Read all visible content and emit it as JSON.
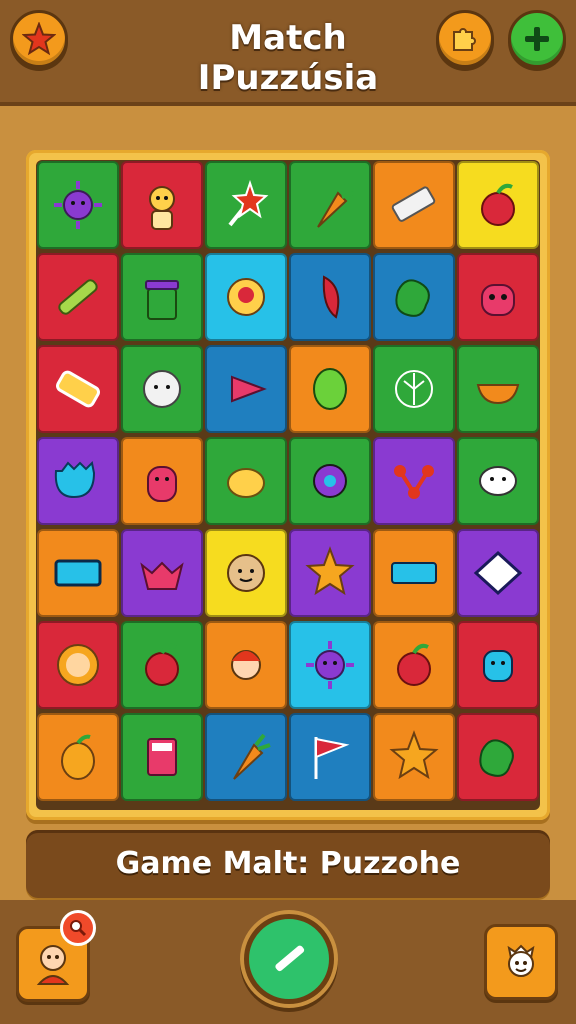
{
  "header": {
    "title_line1": "Match",
    "title_line2": "IPuzzúsia",
    "star_icon": "star-icon",
    "puzzle_icon": "puzzle-icon",
    "add_icon": "plus-icon"
  },
  "board": {
    "rows": 7,
    "cols": 6,
    "tiles": [
      [
        "green",
        "sun-face"
      ],
      [
        "red",
        "person"
      ],
      [
        "green",
        "star-wand"
      ],
      [
        "green",
        "carrot"
      ],
      [
        "orange",
        "eraser"
      ],
      [
        "yellow",
        "apple"
      ],
      [
        "red",
        "stick"
      ],
      [
        "green",
        "bin"
      ],
      [
        "cyan",
        "gem"
      ],
      [
        "blue",
        "chili"
      ],
      [
        "blue",
        "blob"
      ],
      [
        "red",
        "monster"
      ],
      [
        "red",
        "battery"
      ],
      [
        "green",
        "ball-face"
      ],
      [
        "blue",
        "play-arrow"
      ],
      [
        "orange",
        "bean"
      ],
      [
        "green",
        "leaf-ball"
      ],
      [
        "green",
        "bowl"
      ],
      [
        "purple",
        "robot"
      ],
      [
        "orange",
        "cat"
      ],
      [
        "green",
        "lemon"
      ],
      [
        "green",
        "orb"
      ],
      [
        "purple",
        "molecule"
      ],
      [
        "green",
        "speech-face"
      ],
      [
        "orange",
        "screen"
      ],
      [
        "purple",
        "bird"
      ],
      [
        "yellow",
        "face"
      ],
      [
        "purple",
        "star"
      ],
      [
        "orange",
        "toggle"
      ],
      [
        "purple",
        "diamond"
      ],
      [
        "red",
        "lion"
      ],
      [
        "green",
        "apple"
      ],
      [
        "orange",
        "boy"
      ],
      [
        "cyan",
        "sun-face"
      ],
      [
        "orange",
        "apple"
      ],
      [
        "red",
        "robot-head"
      ],
      [
        "orange",
        "mango"
      ],
      [
        "green",
        "calculator"
      ],
      [
        "blue",
        "carrot"
      ],
      [
        "blue",
        "flag"
      ],
      [
        "orange",
        "star"
      ],
      [
        "red",
        "blob"
      ]
    ],
    "colors": {
      "green": "#2fa83a",
      "red": "#d9283a",
      "orange": "#f28a1c",
      "yellow": "#f6dc1f",
      "blue": "#1f7fbf",
      "cyan": "#27c1e8",
      "purple": "#8a3ad1"
    }
  },
  "caption": {
    "text": "Game Malt: Puzzohe"
  },
  "footer": {
    "left_icon": "profile-icon",
    "notif_icon": "search-icon",
    "center_icon": "pencil-icon",
    "right_icon": "character-icon"
  }
}
